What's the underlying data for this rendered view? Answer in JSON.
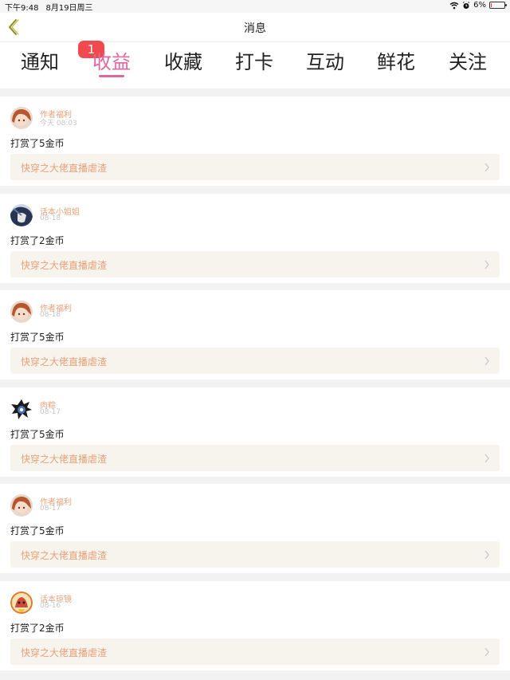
{
  "status_bar": {
    "time": "下午9:48",
    "date": "8月19日周三",
    "battery_text": "6%",
    "battery_level": 0.06,
    "battery_color": "#e2383d"
  },
  "nav": {
    "title": "消息",
    "back_icon": "chevron-left-icon"
  },
  "tabs": [
    {
      "label": "通知",
      "badge": "1"
    },
    {
      "label": "收益",
      "active": true
    },
    {
      "label": "收藏"
    },
    {
      "label": "打卡"
    },
    {
      "label": "互动"
    },
    {
      "label": "鲜花"
    },
    {
      "label": "关注"
    }
  ],
  "colors": {
    "accent": "#e0679b",
    "badge": "#f04a4e",
    "name": "#e7a27a",
    "link_bg": "#f6f4ec"
  },
  "messages": [
    {
      "name": "作者福利",
      "time": "今天 08:03",
      "text": "打赏了5金币",
      "link": "快穿之大佬直播虐渣",
      "avatar": "anime-girl-avatar"
    },
    {
      "name": "话本小姐姐",
      "time": "08-18",
      "text": "打赏了2金币",
      "link": "快穿之大佬直播虐渣",
      "avatar": "anime-character-avatar"
    },
    {
      "name": "作者福利",
      "time": "08-18",
      "text": "打赏了5金币",
      "link": "快穿之大佬直播虐渣",
      "avatar": "anime-girl-avatar"
    },
    {
      "name": "肉粽",
      "time": "08-17",
      "text": "打赏了5金币",
      "link": "快穿之大佬直播虐渣",
      "avatar": "cartoon-avatar"
    },
    {
      "name": "作者福利",
      "time": "08-17",
      "text": "打赏了5金币",
      "link": "快穿之大佬直播虐渣",
      "avatar": "anime-girl-avatar"
    },
    {
      "name": "话本琼镜",
      "time": "08-16",
      "text": "打赏了2金币",
      "link": "快穿之大佬直播虐渣",
      "avatar": "cartoon-mascot-avatar"
    }
  ]
}
